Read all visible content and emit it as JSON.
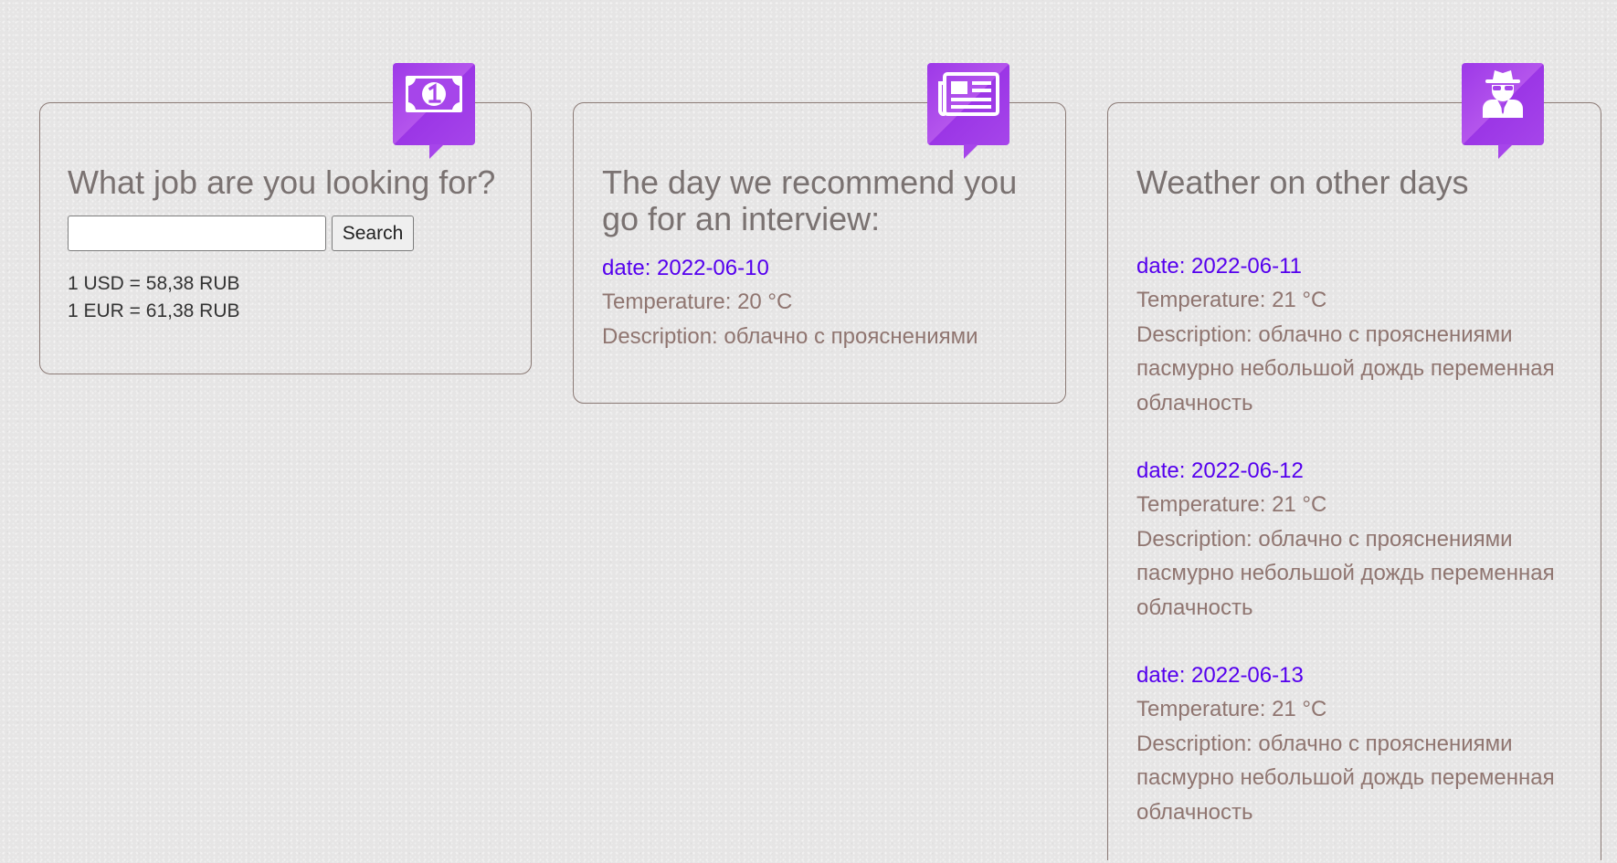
{
  "jobs": {
    "title": "What job are you looking for?",
    "search_value": "",
    "search_placeholder": "",
    "search_button_label": "Search",
    "rates": [
      "1 USD = 58,38 RUB",
      "1 EUR = 61,38 RUB"
    ]
  },
  "recommend": {
    "title": "The day we recommend you go for an interview:",
    "date": "date: 2022-06-10",
    "temperature": "Temperature: 20 °C",
    "description": "Description: облачно с прояснениями"
  },
  "weather": {
    "title": "Weather on other days",
    "days": [
      {
        "date": "date: 2022-06-11",
        "temperature": "Temperature: 21 °C",
        "description": "Description: облачно с прояснениями пасмурно небольшой дождь переменная облачность"
      },
      {
        "date": "date: 2022-06-12",
        "temperature": "Temperature: 21 °C",
        "description": "Description: облачно с прояснениями пасмурно небольшой дождь переменная облачность"
      },
      {
        "date": "date: 2022-06-13",
        "temperature": "Temperature: 21 °C",
        "description": "Description: облачно с прояснениями пасмурно небольшой дождь переменная облачность"
      }
    ]
  },
  "icons": {
    "jobs_badge": "money-bill-icon",
    "recommend_badge": "newspaper-icon",
    "weather_badge": "user-secret-icon"
  },
  "colors": {
    "badge": "#a645ea",
    "date_link": "#5500ee",
    "body_text": "#8f7570",
    "title_text": "#7a7271",
    "card_border": "#8b7a75"
  }
}
